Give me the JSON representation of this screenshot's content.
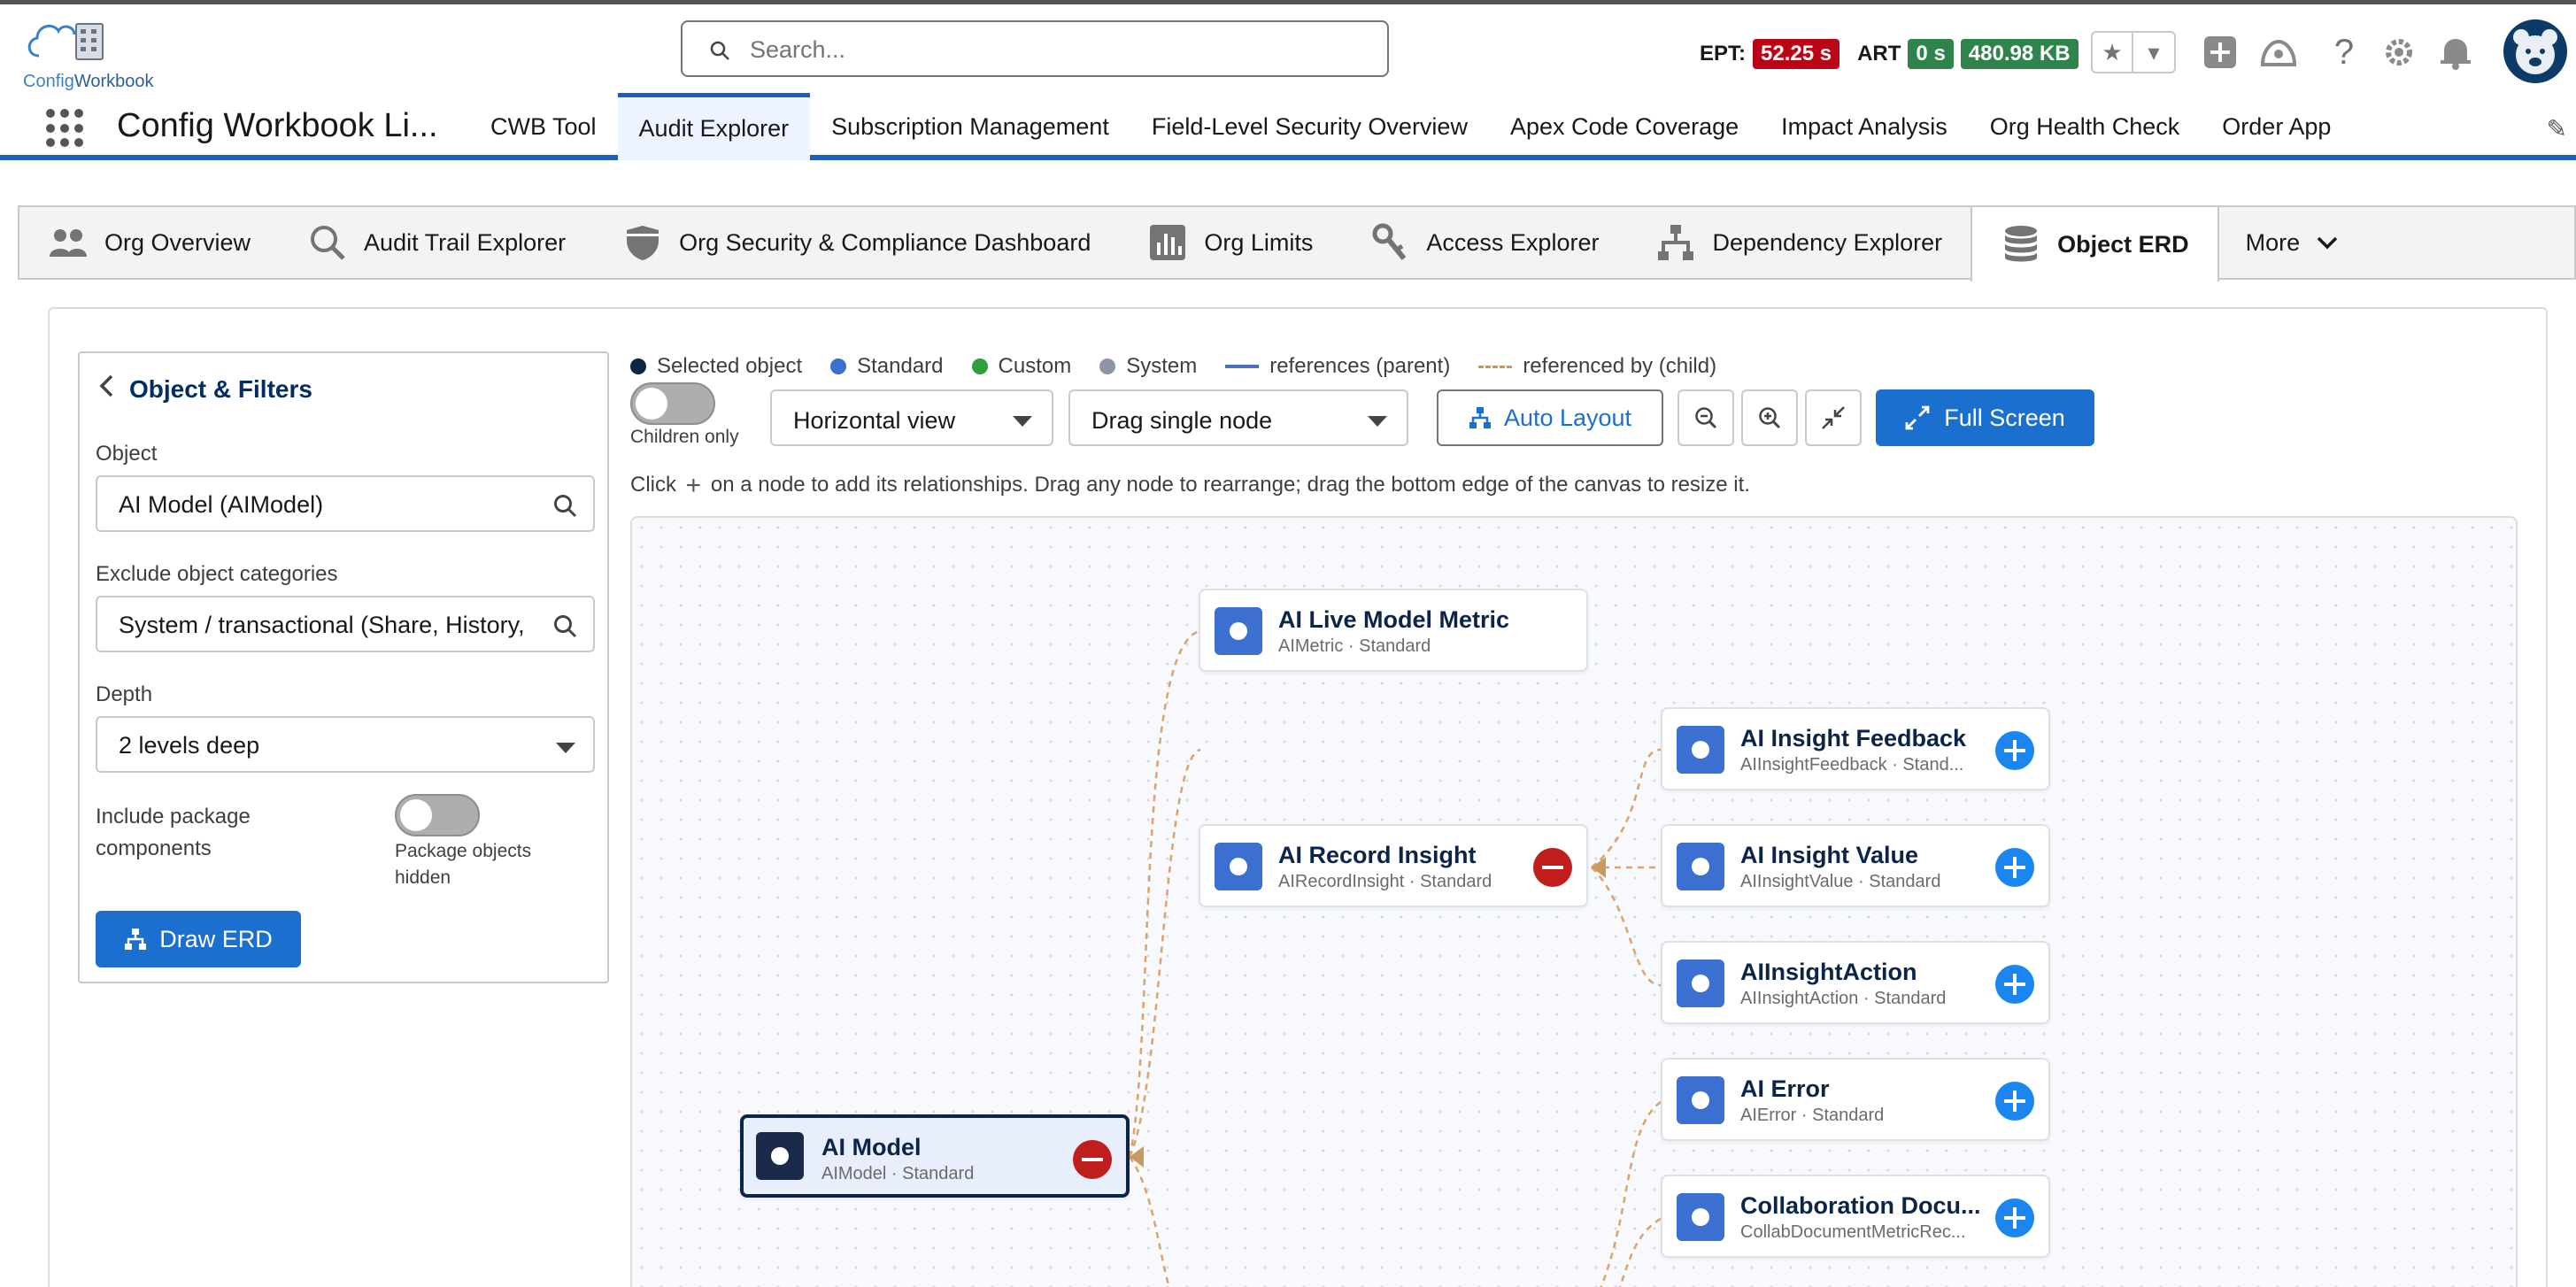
{
  "brand": {
    "logo_text_a": "Config",
    "logo_text_b": "Workbook"
  },
  "search": {
    "placeholder": "Search..."
  },
  "metrics": {
    "ept_label": "EPT:",
    "ept_value": "52.25 s",
    "art_label": "ART",
    "art_value": "0 s",
    "size_value": "480.98 KB"
  },
  "header_icons": [
    "favorite-star-icon",
    "favorites-menu-icon",
    "global-add-icon",
    "trailhead-icon",
    "help-icon",
    "setup-gear-icon",
    "notifications-bell-icon"
  ],
  "nav": {
    "app_name": "Config Workbook Li...",
    "items": [
      "CWB Tool",
      "Audit Explorer",
      "Subscription Management",
      "Field-Level Security Overview",
      "Apex Code Coverage",
      "Impact Analysis",
      "Org Health Check",
      "Order App"
    ],
    "active_index": 1
  },
  "tabs": {
    "items": [
      {
        "label": "Org Overview",
        "icon": "users-icon"
      },
      {
        "label": "Audit Trail Explorer",
        "icon": "search-icon"
      },
      {
        "label": "Org Security & Compliance Dashboard",
        "icon": "shield-icon"
      },
      {
        "label": "Org Limits",
        "icon": "bar-chart-icon"
      },
      {
        "label": "Access Explorer",
        "icon": "key-icon"
      },
      {
        "label": "Dependency Explorer",
        "icon": "hierarchy-icon"
      },
      {
        "label": "Object ERD",
        "icon": "database-icon"
      }
    ],
    "more_label": "More",
    "active_index": 6
  },
  "filters": {
    "title": "Object & Filters",
    "object_label": "Object",
    "object_value": "AI Model (AIModel)",
    "exclude_label": "Exclude object categories",
    "exclude_value": "System / transactional (Share, History,",
    "depth_label": "Depth",
    "depth_value": "2 levels deep",
    "package_label": "Include package components",
    "package_hint": "Package objects hidden",
    "draw_button": "Draw ERD"
  },
  "legend": {
    "selected": "Selected object",
    "standard": "Standard",
    "custom": "Custom",
    "system": "System",
    "parent": "references (parent)",
    "child": "referenced by (child)",
    "colors": {
      "selected": "#0b2447",
      "standard": "#3b6fd1",
      "custom": "#2e9e3e",
      "system": "#8e96a6",
      "parent_line": "#4a6fc4",
      "child_line": "#d9924a"
    }
  },
  "toolbar": {
    "children_only": "Children only",
    "view_select": "Horizontal view",
    "drag_select": "Drag single node",
    "auto_layout": "Auto Layout",
    "full_screen": "Full Screen"
  },
  "hint": {
    "before": "Click",
    "after": "on a node to add its relationships. Drag any node to rearrange; drag the bottom edge of the canvas to resize it."
  },
  "nodes": [
    {
      "title": "AI Live Model Metric",
      "sub": "AIMetric · Standard",
      "action": "none"
    },
    {
      "title": "AI Record Insight",
      "sub": "AIRecordInsight · Standard",
      "action": "remove"
    },
    {
      "title": "AI Insight Feedback",
      "sub": "AIInsightFeedback · Stand...",
      "action": "add"
    },
    {
      "title": "AI Insight Value",
      "sub": "AIInsightValue · Standard",
      "action": "add"
    },
    {
      "title": "AIInsightAction",
      "sub": "AIInsightAction · Standard",
      "action": "add"
    },
    {
      "title": "AI Error",
      "sub": "AIError · Standard",
      "action": "add"
    },
    {
      "title": "Collaboration Docu...",
      "sub": "CollabDocumentMetricRec...",
      "action": "add"
    },
    {
      "title": "AI Model",
      "sub": "AIModel · Standard",
      "action": "remove",
      "selected": true
    }
  ]
}
